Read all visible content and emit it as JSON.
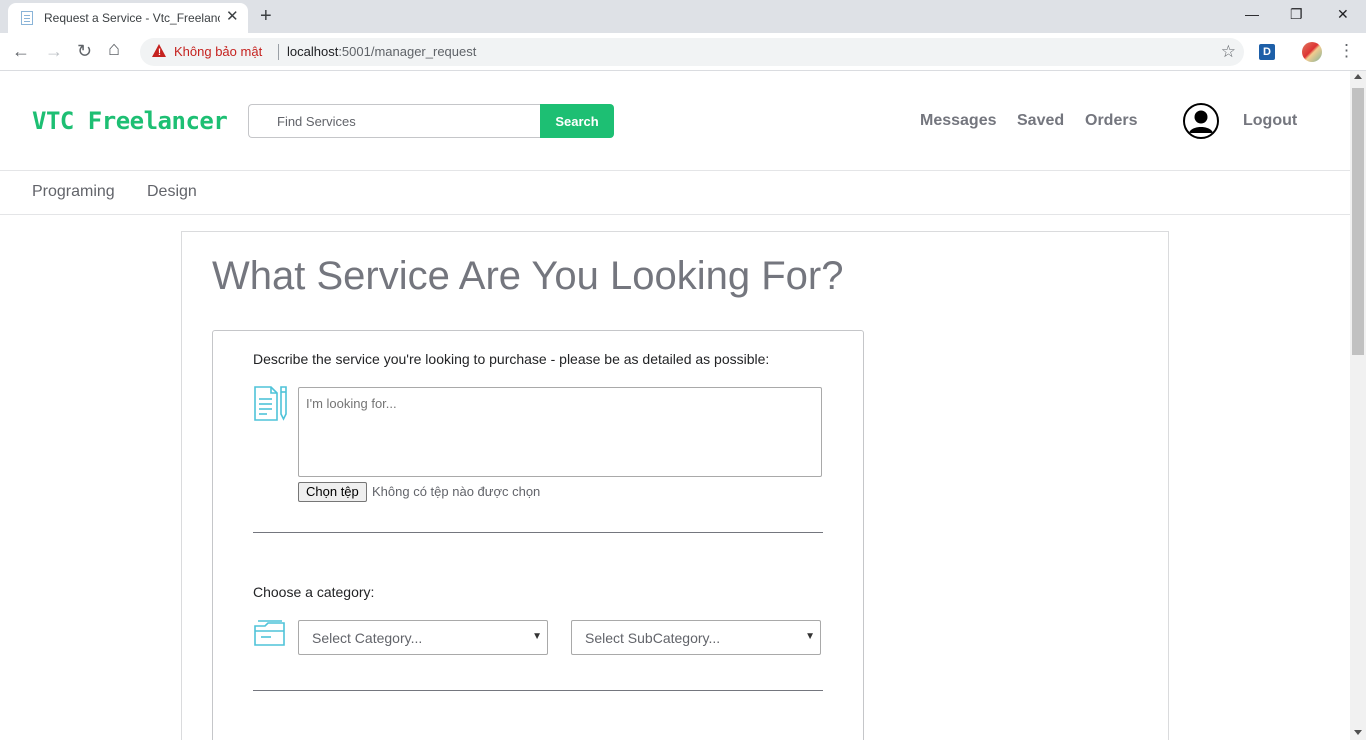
{
  "browser": {
    "tab_title": "Request a Service - Vtc_Freelancer",
    "tab_close": "✕",
    "new_tab": "+",
    "window_controls": {
      "minimize": "—",
      "restore": "❐",
      "close": "✕"
    },
    "nav": {
      "back": "←",
      "forward": "→",
      "reload": "↻",
      "home": "⌂"
    },
    "security_label": "Không bảo mật",
    "url_host": "localhost",
    "url_path": ":5001/manager_request",
    "star": "☆",
    "extension_label": "D",
    "menu": "⋮",
    "icons": [
      "page-favicon-icon",
      "back-arrow-icon",
      "forward-arrow-icon",
      "reload-icon",
      "home-icon",
      "warning-icon",
      "star-icon",
      "extension-d-icon",
      "profile-icon",
      "menu-dots-icon"
    ]
  },
  "header": {
    "logo": "VTC Freelancer",
    "search": {
      "placeholder": "Find Services",
      "button_label": "Search"
    },
    "nav": {
      "messages": "Messages",
      "saved": "Saved",
      "orders": "Orders",
      "logout": "Logout"
    }
  },
  "subnav": {
    "items": [
      "Programing",
      "Design"
    ]
  },
  "main": {
    "title": "What Service Are You Looking For?",
    "describe_label": "Describe the service you're looking to purchase - please be as detailed as possible:",
    "textarea_placeholder": "I'm looking for...",
    "file": {
      "button_label": "Chọn tệp",
      "status": "Không có tệp nào được chọn"
    },
    "category_label": "Choose a category:",
    "category_select": "Select Category...",
    "subcategory_select": "Select SubCategory...",
    "select_caret": "▼"
  },
  "colors": {
    "brand": "#1dbf73",
    "accent_icon": "#4fc3d9",
    "text_muted": "#74767e",
    "security_warning": "#c5221f"
  }
}
